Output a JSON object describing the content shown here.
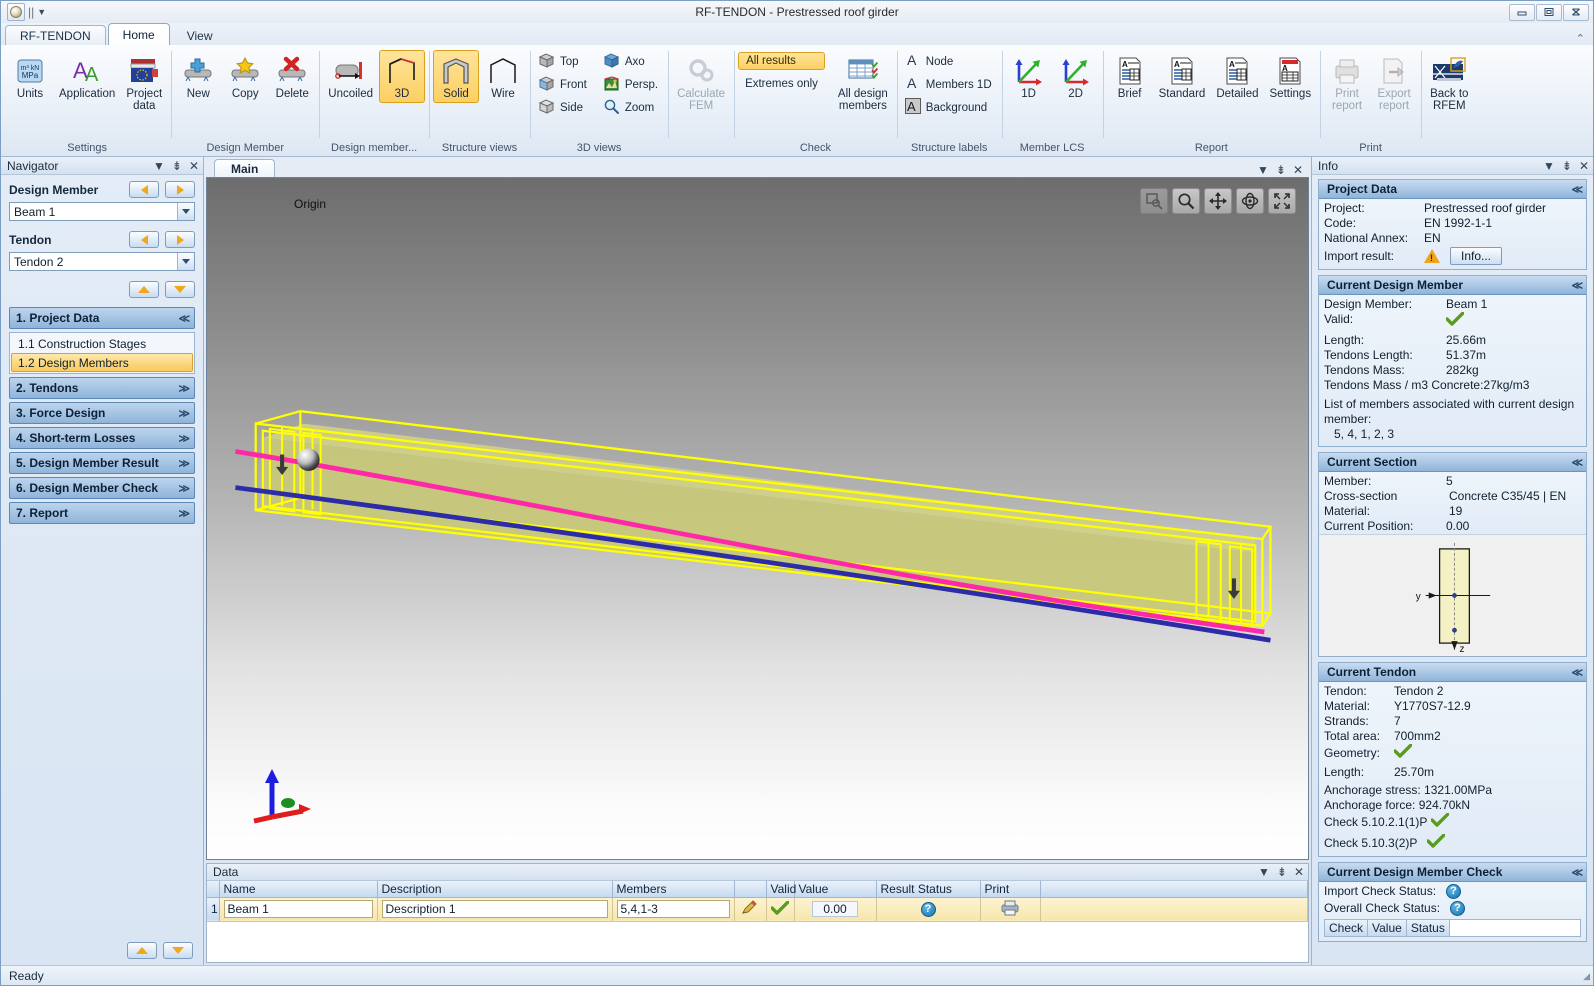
{
  "window": {
    "title": "RF-TENDON - Prestressed roof girder",
    "minimize": "minimize-icon",
    "restore": "restore-icon",
    "close": "close-icon"
  },
  "quick_access": {
    "orb": "app-orb-icon",
    "separator": "||",
    "dropdown": "chevron-down-icon"
  },
  "tabs": [
    {
      "label": "RF-TENDON",
      "active": false
    },
    {
      "label": "Home",
      "active": true
    },
    {
      "label": "View",
      "active": false
    }
  ],
  "ribbon": {
    "collapse": "collapse-ribbon-icon",
    "groups": [
      {
        "label": "Settings",
        "buttons": [
          {
            "label": "Units",
            "icon": "units-icon"
          },
          {
            "label": "Application",
            "icon": "application-icon"
          },
          {
            "label": "Project\ndata",
            "icon": "project-data-icon"
          }
        ]
      },
      {
        "label": "Design Member",
        "buttons": [
          {
            "label": "New",
            "icon": "new-member-icon"
          },
          {
            "label": "Copy",
            "icon": "copy-member-icon"
          },
          {
            "label": "Delete",
            "icon": "delete-member-icon"
          }
        ]
      },
      {
        "label": "Design member...",
        "buttons": [
          {
            "label": "Uncoiled",
            "icon": "uncoiled-icon",
            "selected": false
          },
          {
            "label": "3D",
            "icon": "3d-view-icon",
            "selected": true
          }
        ]
      },
      {
        "label": "Structure views",
        "buttons": [
          {
            "label": "Solid",
            "icon": "solid-view-icon",
            "selected": true
          },
          {
            "label": "Wire",
            "icon": "wire-view-icon",
            "selected": false
          }
        ]
      },
      {
        "label": "3D views",
        "small_buttons": [
          {
            "label": "Top",
            "icon": "view-top-icon"
          },
          {
            "label": "Front",
            "icon": "view-front-icon"
          },
          {
            "label": "Side",
            "icon": "view-side-icon"
          },
          {
            "label": "Axo",
            "icon": "view-axo-icon"
          },
          {
            "label": "Persp.",
            "icon": "view-perspective-icon"
          },
          {
            "label": "Zoom",
            "icon": "zoom-icon"
          }
        ]
      },
      {
        "label": "",
        "buttons": [
          {
            "label": "Calculate\nFEM",
            "icon": "calculate-fem-icon",
            "disabled": true
          }
        ]
      },
      {
        "label": "Check",
        "toggle_all_results": "All results",
        "toggle_extremes": "Extremes only",
        "buttons": [
          {
            "label": "All design\nmembers",
            "icon": "all-design-members-icon"
          }
        ]
      },
      {
        "label": "Structure labels",
        "small_buttons": [
          {
            "label": "Node",
            "icon": "label-node-icon"
          },
          {
            "label": "Members 1D",
            "icon": "label-members-1d-icon"
          },
          {
            "label": "Background",
            "icon": "label-background-icon"
          }
        ]
      },
      {
        "label": "Member LCS",
        "buttons": [
          {
            "label": "1D",
            "icon": "lcs-1d-icon"
          },
          {
            "label": "2D",
            "icon": "lcs-2d-icon"
          }
        ]
      },
      {
        "label": "Report",
        "buttons": [
          {
            "label": "Brief",
            "icon": "report-brief-icon"
          },
          {
            "label": "Standard",
            "icon": "report-standard-icon"
          },
          {
            "label": "Detailed",
            "icon": "report-detailed-icon"
          },
          {
            "label": "Settings",
            "icon": "report-settings-icon"
          }
        ]
      },
      {
        "label": "Print",
        "buttons": [
          {
            "label": "Print\nreport",
            "icon": "print-report-icon",
            "disabled": true
          },
          {
            "label": "Export\nreport",
            "icon": "export-report-icon",
            "disabled": true
          }
        ]
      },
      {
        "label": "",
        "buttons": [
          {
            "label": "Back to\nRFEM",
            "icon": "back-to-rfem-icon"
          }
        ]
      }
    ]
  },
  "navigator": {
    "title": "Navigator",
    "tools": {
      "menu": "chevron-down-icon",
      "pin": "pin-icon",
      "close": "close-icon"
    },
    "design_member": {
      "label": "Design Member",
      "value": "Beam 1",
      "prev": "prev-icon",
      "next": "next-icon"
    },
    "tendon": {
      "label": "Tendon",
      "value": "Tendon 2",
      "prev": "prev-icon",
      "next": "next-icon"
    },
    "updown": {
      "up": "up-icon",
      "down": "down-icon"
    },
    "sections": [
      {
        "label": "1. Project Data",
        "expanded": true,
        "chevron": "chevron-up-double-icon",
        "items": [
          {
            "label": "1.1 Construction Stages",
            "selected": false
          },
          {
            "label": "1.2 Design Members",
            "selected": true
          }
        ]
      },
      {
        "label": "2. Tendons",
        "expanded": false,
        "chevron": "chevron-down-double-icon",
        "items": []
      },
      {
        "label": "3. Force Design",
        "expanded": false,
        "chevron": "chevron-down-double-icon",
        "items": []
      },
      {
        "label": "4. Short-term Losses",
        "expanded": false,
        "chevron": "chevron-down-double-icon",
        "items": []
      },
      {
        "label": "5. Design Member Result",
        "expanded": false,
        "chevron": "chevron-down-double-icon",
        "items": []
      },
      {
        "label": "6. Design Member Check",
        "expanded": false,
        "chevron": "chevron-down-double-icon",
        "items": []
      },
      {
        "label": "7. Report",
        "expanded": false,
        "chevron": "chevron-down-double-icon",
        "items": []
      }
    ],
    "footer": {
      "up": "up-icon",
      "down": "down-icon"
    }
  },
  "viewport": {
    "tab_label": "Main",
    "tools": {
      "menu": "chevron-down-icon",
      "pin": "pin-icon",
      "close": "close-icon"
    },
    "buttons": [
      {
        "name": "zoom-window-button",
        "icon": "zoom-window-icon",
        "disabled": true
      },
      {
        "name": "zoom-button",
        "icon": "magnifier-icon",
        "disabled": false
      },
      {
        "name": "pan-button",
        "icon": "move-icon",
        "disabled": false
      },
      {
        "name": "rotate-button",
        "icon": "rotate-icon",
        "disabled": false
      },
      {
        "name": "fit-all-button",
        "icon": "fit-all-icon",
        "disabled": false
      }
    ],
    "origin_label": "Origin",
    "axis_indicator": "axis-triad-icon"
  },
  "data_panel": {
    "title": "Data",
    "tools": {
      "menu": "chevron-down-icon",
      "pin": "pin-icon",
      "close": "close-icon"
    },
    "columns": [
      "",
      "Name",
      "Description",
      "Members",
      "",
      "Valid",
      "Value",
      "Result Status",
      "Print",
      ""
    ],
    "rows": [
      {
        "no": "1",
        "name": "Beam 1",
        "description": "Description 1",
        "members": "5,4,1-3",
        "edit": "pencil-icon",
        "valid": "check-icon",
        "value": "0.00",
        "result_status": "question-icon",
        "print": "printer-icon"
      }
    ]
  },
  "info": {
    "title": "Info",
    "tools": {
      "menu": "chevron-down-icon",
      "pin": "pin-icon",
      "close": "close-icon"
    },
    "project_data": {
      "heading": "Project Data",
      "chevron": "chevron-up-double-icon",
      "project_label": "Project:",
      "project_value": "Prestressed roof girder",
      "code_label": "Code:",
      "code_value": "EN 1992-1-1",
      "annex_label": "National Annex:",
      "annex_value": "EN",
      "import_label": "Import result:",
      "import_warning": "warning-icon",
      "import_button": "Info..."
    },
    "current_design_member": {
      "heading": "Current Design Member",
      "chevron": "chevron-up-double-icon",
      "member_label": "Design Member:",
      "member_value": "Beam 1",
      "valid_label": "Valid:",
      "valid_icon": "check-icon",
      "length_label": "Length:",
      "length_value": "25.66m",
      "tendons_length_label": "Tendons Length:",
      "tendons_length_value": "51.37m",
      "tendons_mass_label": "Tendons Mass:",
      "tendons_mass_value": "282kg",
      "tendons_mass_m3": "Tendons Mass / m3 Concrete:27kg/m3",
      "list_label": "List of members associated with current design member:",
      "list_value": "5, 4, 1, 2, 3"
    },
    "current_section": {
      "heading": "Current Section",
      "chevron": "chevron-up-double-icon",
      "member_label": "Member:",
      "member_value": "5",
      "material_label": "Cross-section Material:",
      "material_value": "Concrete C35/45 | EN 19",
      "position_label": "Current Position:",
      "position_value": "0.00",
      "axis_y": "y",
      "axis_z": "z"
    },
    "current_tendon": {
      "heading": "Current Tendon",
      "chevron": "chevron-up-double-icon",
      "tendon_label": "Tendon:",
      "tendon_value": "Tendon 2",
      "material_label": "Material:",
      "material_value": "Y1770S7-12.9",
      "strands_label": "Strands:",
      "strands_value": "7",
      "area_label": "Total area:",
      "area_value": "700mm2",
      "geometry_label": "Geometry:",
      "geometry_icon": "check-icon",
      "length_label": "Length:",
      "length_value": "25.70m",
      "anchorage_stress": "Anchorage stress: 1321.00MPa",
      "anchorage_force": "Anchorage force:  924.70kN",
      "check1": "Check 5.10.2.1(1)P",
      "check2": "Check 5.10.3(2)P"
    },
    "current_member_check": {
      "heading": "Current Design Member Check",
      "chevron": "chevron-up-double-icon",
      "import_label": "Import Check Status:",
      "import_icon": "question-icon",
      "overall_label": "Overall Check Status:",
      "overall_icon": "question-icon",
      "table_headers": [
        "Check",
        "Value",
        "Status"
      ]
    }
  },
  "statusbar": {
    "text": "Ready"
  },
  "colors": {
    "accent_selected": "#fccf62",
    "tendon_pink": "#ff29a8",
    "tendon_blue": "#2c2ca8",
    "beam_yellow": "#ffff00",
    "check_green": "#5a9c1e",
    "warning_orange": "#f0a21b"
  }
}
